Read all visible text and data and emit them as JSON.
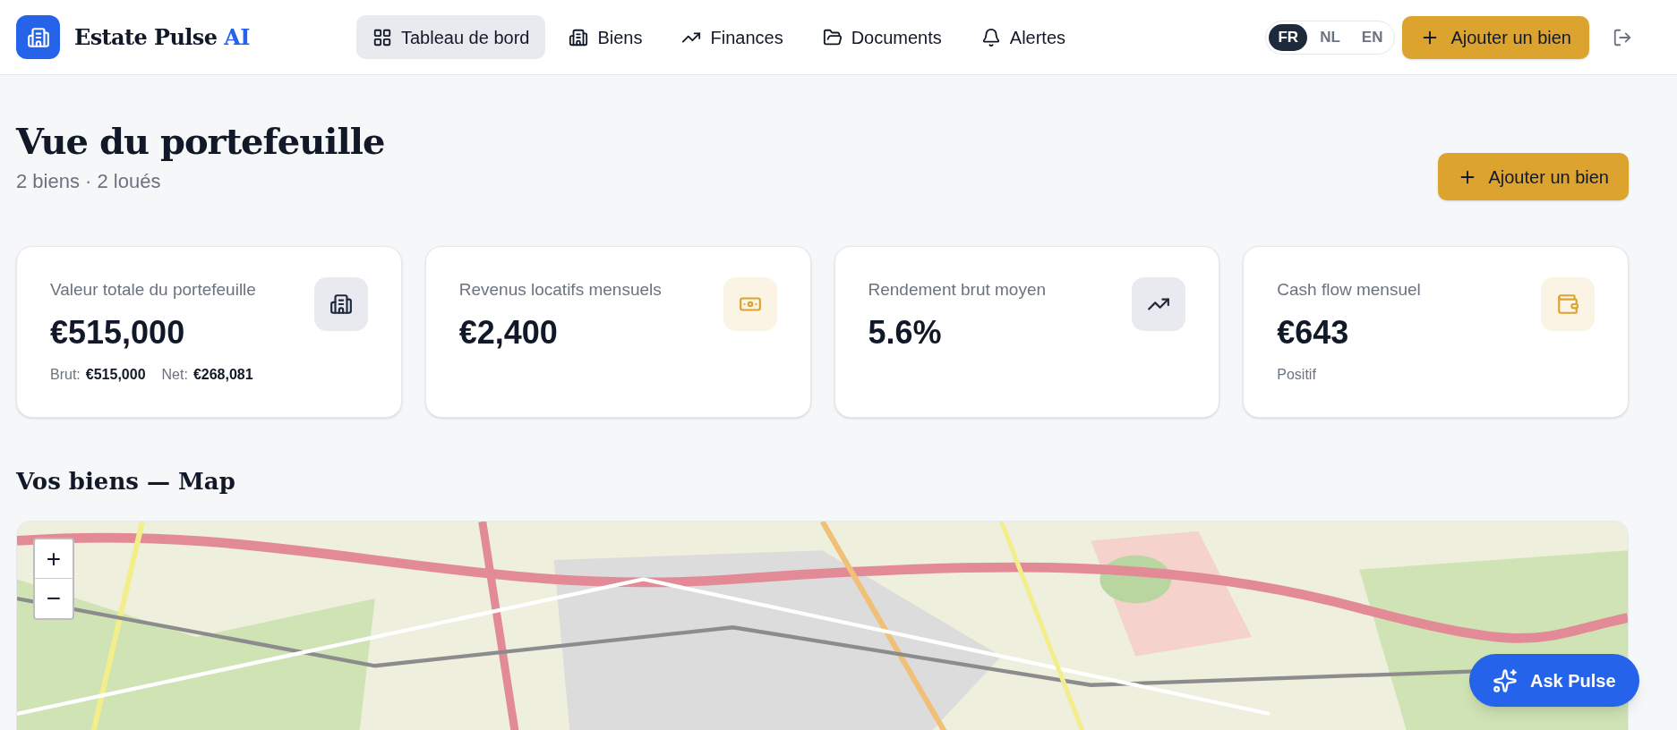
{
  "header": {
    "brand": "Estate Pulse",
    "brand_accent": "AI",
    "nav": [
      {
        "label": "Tableau de bord",
        "selected": true
      },
      {
        "label": "Biens",
        "selected": false
      },
      {
        "label": "Finances",
        "selected": false
      },
      {
        "label": "Documents",
        "selected": false
      },
      {
        "label": "Alertes",
        "selected": false
      }
    ],
    "languages": [
      {
        "label": "FR",
        "selected": true
      },
      {
        "label": "NL",
        "selected": false
      },
      {
        "label": "EN",
        "selected": false
      }
    ],
    "add_button": "Ajouter un bien"
  },
  "page": {
    "title": "Vue du portefeuille",
    "subtitle": "2 biens · 2 loués",
    "add_button": "Ajouter un bien"
  },
  "stats": [
    {
      "label": "Valeur totale du portefeuille",
      "value": "€515,000",
      "details": [
        {
          "label": "Brut:",
          "value": "€515,000"
        },
        {
          "label": "Net:",
          "value": "€268,081"
        }
      ]
    },
    {
      "label": "Revenus locatifs mensuels",
      "value": "€2,400"
    },
    {
      "label": "Rendement brut moyen",
      "value": "5.6%"
    },
    {
      "label": "Cash flow mensuel",
      "value": "€643",
      "note": "Positif"
    }
  ],
  "map_section": {
    "title": "Vos biens — Map",
    "zoom_in": "+",
    "zoom_out": "−"
  },
  "assistant_button": "Ask Pulse"
}
